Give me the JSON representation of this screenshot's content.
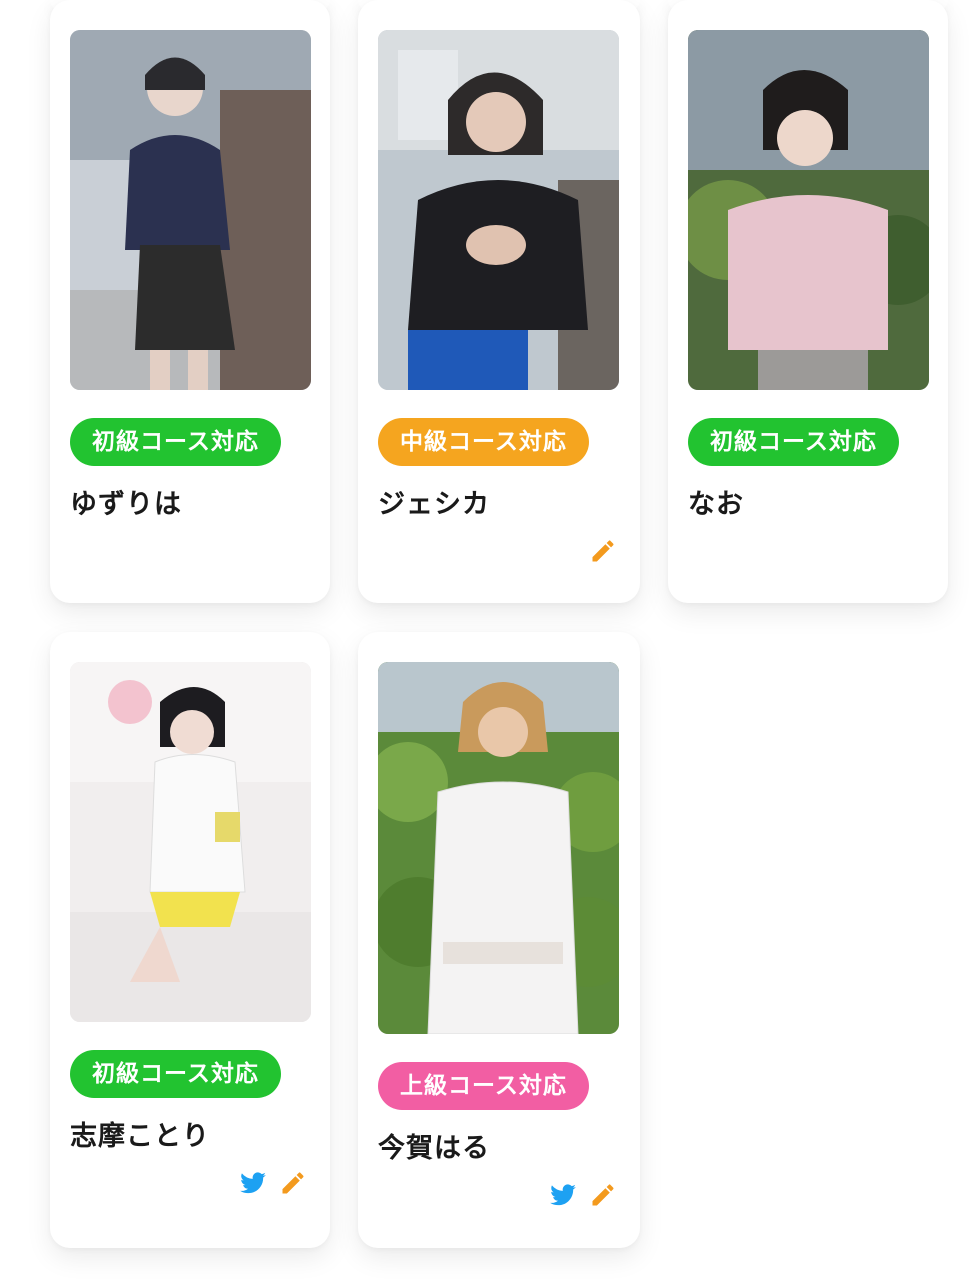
{
  "colors": {
    "beginner": "#22c330",
    "intermediate": "#f5a51f",
    "advanced": "#f25ea3",
    "edit_icon": "#f39a1e",
    "twitter_icon": "#1da1f2"
  },
  "cards": [
    {
      "name": "ゆずりは",
      "badge": "初級コース対応",
      "level": "beginner",
      "icons": []
    },
    {
      "name": "ジェシカ",
      "badge": "中級コース対応",
      "level": "intermediate",
      "icons": [
        "pencil-icon"
      ]
    },
    {
      "name": "なお",
      "badge": "初級コース対応",
      "level": "beginner",
      "icons": []
    },
    {
      "name": "志摩ことり",
      "badge": "初級コース対応",
      "level": "beginner",
      "icons": [
        "twitter-icon",
        "pencil-icon"
      ]
    },
    {
      "name": "今賀はる",
      "badge": "上級コース対応",
      "level": "advanced",
      "icons": [
        "twitter-icon",
        "pencil-icon"
      ]
    }
  ]
}
